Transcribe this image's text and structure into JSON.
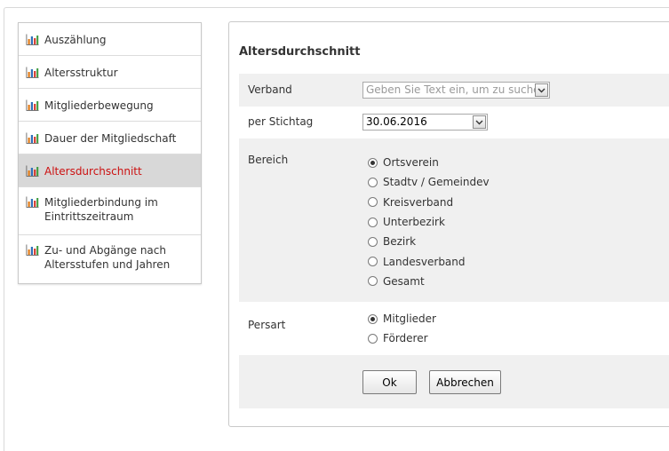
{
  "sidebar": {
    "items": [
      {
        "label": "Auszählung",
        "active": false
      },
      {
        "label": "Altersstruktur",
        "active": false
      },
      {
        "label": "Mitgliederbewegung",
        "active": false
      },
      {
        "label": "Dauer der Mitgliedschaft",
        "active": false
      },
      {
        "label": "Altersdurchschnitt",
        "active": true
      },
      {
        "label": "Mitgliederbindung im Eintrittszeitraum",
        "active": false
      },
      {
        "label": "Zu- und Abgänge nach Altersstufen und Jahren",
        "active": false
      }
    ],
    "icon": "bar-chart-icon",
    "active_color": "#cc1111"
  },
  "form": {
    "title": "Altersdurchschnitt",
    "verband": {
      "label": "Verband",
      "placeholder": "Geben Sie Text ein, um zu suchen"
    },
    "stichtag": {
      "label": "per Stichtag",
      "value": "30.06.2016"
    },
    "bereich": {
      "label": "Bereich",
      "options": [
        "Ortsverein",
        "Stadtv / Gemeindev",
        "Kreisverband",
        "Unterbezirk",
        "Bezirk",
        "Landesverband",
        "Gesamt"
      ],
      "selected": "Ortsverein"
    },
    "persart": {
      "label": "Persart",
      "options": [
        "Mitglieder",
        "Förderer"
      ],
      "selected": "Mitglieder"
    },
    "buttons": {
      "ok": "Ok",
      "cancel": "Abbrechen"
    }
  }
}
